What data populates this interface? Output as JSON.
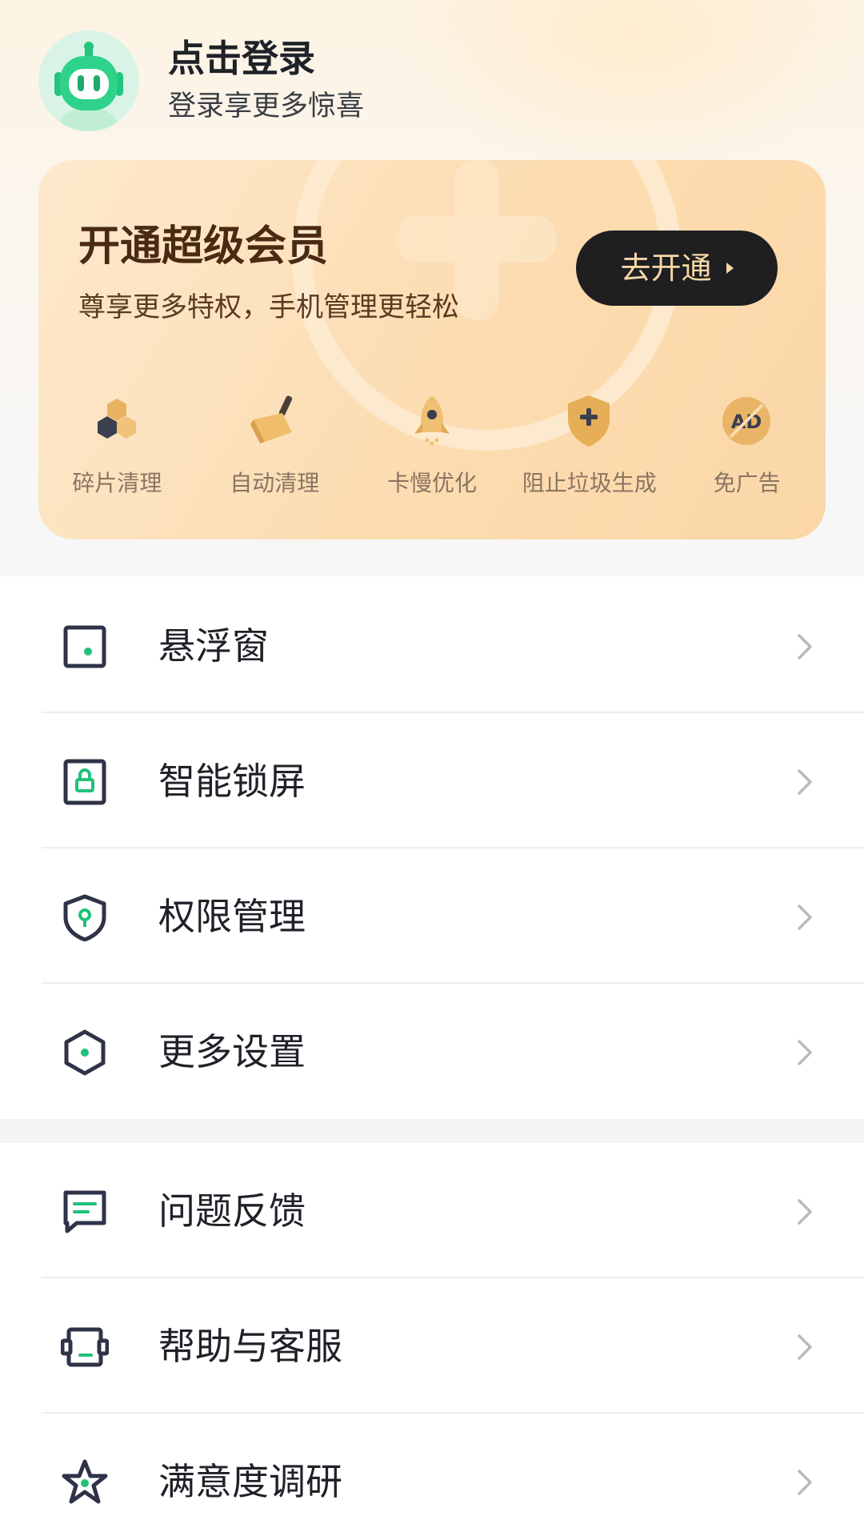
{
  "profile": {
    "login_title": "点击登录",
    "login_subtitle": "登录享更多惊喜"
  },
  "vip": {
    "title": "开通超级会员",
    "subtitle": "尊享更多特权，手机管理更轻松",
    "button_label": "去开通",
    "benefits": [
      {
        "label": "碎片清理",
        "icon": "honeycomb-icon"
      },
      {
        "label": "自动清理",
        "icon": "broom-icon"
      },
      {
        "label": "卡慢优化",
        "icon": "rocket-icon"
      },
      {
        "label": "阻止垃圾生成",
        "icon": "shield-plus-icon"
      },
      {
        "label": "免广告",
        "icon": "no-ad-icon"
      }
    ]
  },
  "menu_group_1": [
    {
      "label": "悬浮窗",
      "icon": "floating-window-icon"
    },
    {
      "label": "智能锁屏",
      "icon": "lock-screen-icon"
    },
    {
      "label": "权限管理",
      "icon": "permission-shield-icon"
    },
    {
      "label": "更多设置",
      "icon": "settings-hexagon-icon"
    }
  ],
  "menu_group_2": [
    {
      "label": "问题反馈",
      "icon": "feedback-icon"
    },
    {
      "label": "帮助与客服",
      "icon": "customer-service-icon"
    },
    {
      "label": "满意度调研",
      "icon": "star-icon"
    }
  ],
  "colors": {
    "accent_green": "#21c17a",
    "icon_dark": "#2f3348",
    "vip_gold": "#f6d7a6",
    "vip_brown": "#4a2a12"
  }
}
